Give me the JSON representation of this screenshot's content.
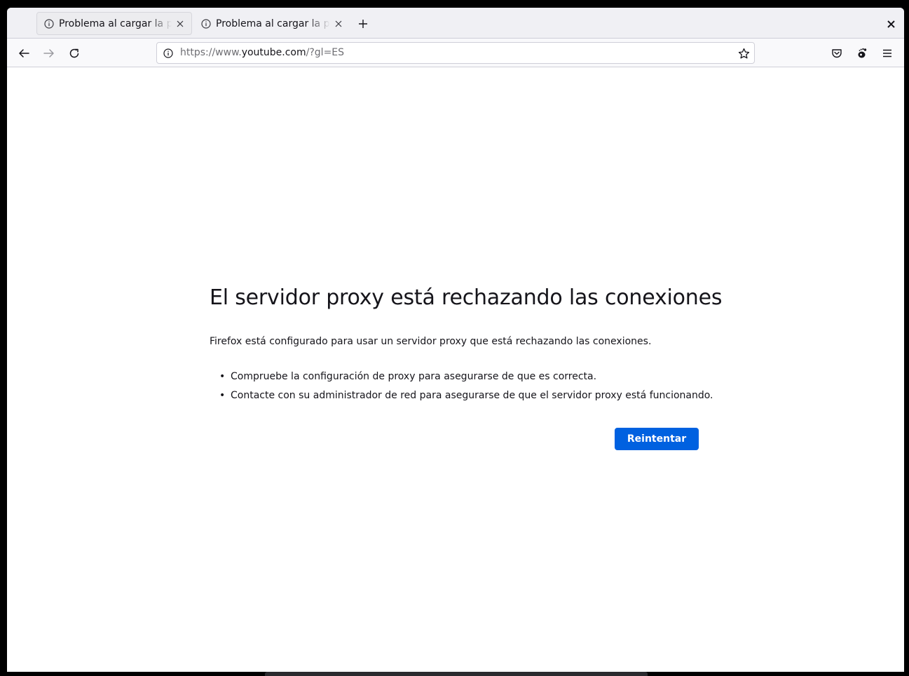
{
  "tabs": [
    {
      "title": "Problema al cargar la página",
      "active": true
    },
    {
      "title": "Problema al cargar la página",
      "active": false
    }
  ],
  "urlbar": {
    "scheme": "https://www.",
    "host": "youtube.com",
    "path": "/?gl=ES"
  },
  "error": {
    "title": "El servidor proxy está rechazando las conexiones",
    "description": "Firefox está configurado para usar un servidor proxy que está rechazando las conexiones.",
    "items": [
      "Compruebe la configuración de proxy para asegurarse de que es correcta.",
      "Contacte con su administrador de red para asegurarse de que el servidor proxy está funcionando."
    ],
    "retry_label": "Reintentar"
  },
  "icons": {
    "tab_icon": "info-icon",
    "tab_close": "close-icon",
    "new_tab": "plus-icon",
    "window_close": "close-icon",
    "back": "arrow-left-icon",
    "forward": "arrow-right-icon",
    "reload": "reload-icon",
    "site_info": "info-icon",
    "bookmark": "star-icon",
    "pocket": "pocket-icon",
    "extension": "gnome-foot-icon",
    "menu": "hamburger-menu-icon"
  },
  "colors": {
    "accent": "#0061e0",
    "text": "#15141a",
    "toolbar": "#f9f9fb",
    "tabstrip": "#f0f0f4"
  }
}
